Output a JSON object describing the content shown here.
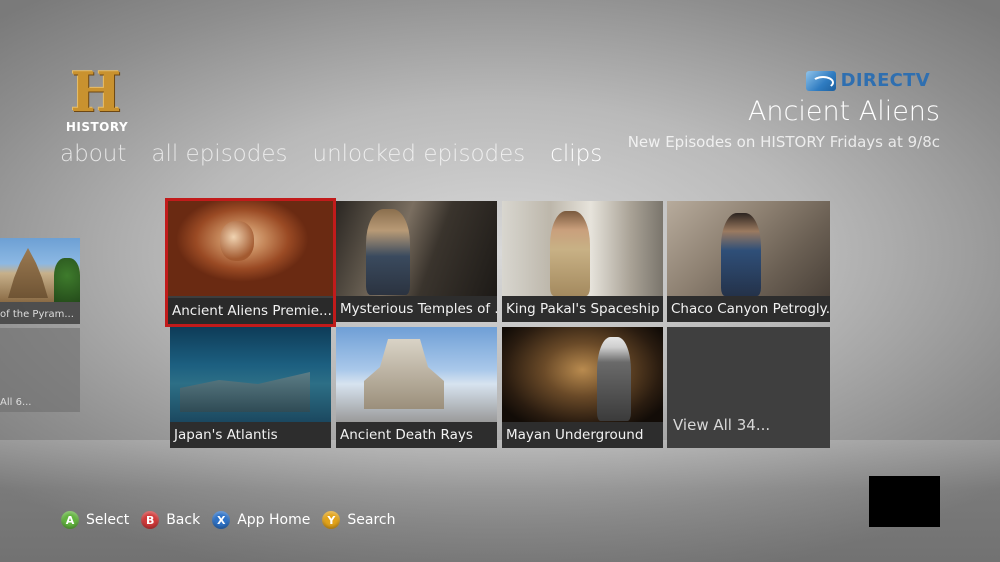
{
  "logo": {
    "letter": "H",
    "word": "HISTORY"
  },
  "tabs": [
    {
      "label": "about",
      "active": false
    },
    {
      "label": "all episodes",
      "active": false
    },
    {
      "label": "unlocked episodes",
      "active": false
    },
    {
      "label": "clips",
      "active": true
    }
  ],
  "header": {
    "provider": "DIRECTV",
    "show_title": "Ancient Aliens",
    "subtitle": "New Episodes on HISTORY Fridays at 9/8c"
  },
  "side_tiles": [
    {
      "label": "of the Pyram..."
    },
    {
      "label": "All 6..."
    }
  ],
  "tiles": [
    {
      "title": "Ancient Aliens Premie...",
      "focused": true
    },
    {
      "title": "Mysterious Temples of ..."
    },
    {
      "title": "King Pakal's Spaceship"
    },
    {
      "title": "Chaco Canyon Petrogly..."
    },
    {
      "title": "Japan's Atlantis"
    },
    {
      "title": "Ancient Death Rays"
    },
    {
      "title": "Mayan Underground"
    },
    {
      "title": "View All 34..."
    }
  ],
  "controls": [
    {
      "key": "A",
      "label": "Select",
      "color": "#62b33f"
    },
    {
      "key": "B",
      "label": "Back",
      "color": "#d03a3a"
    },
    {
      "key": "X",
      "label": "App Home",
      "color": "#2e72c6"
    },
    {
      "key": "Y",
      "label": "Search",
      "color": "#e2a31a"
    }
  ]
}
